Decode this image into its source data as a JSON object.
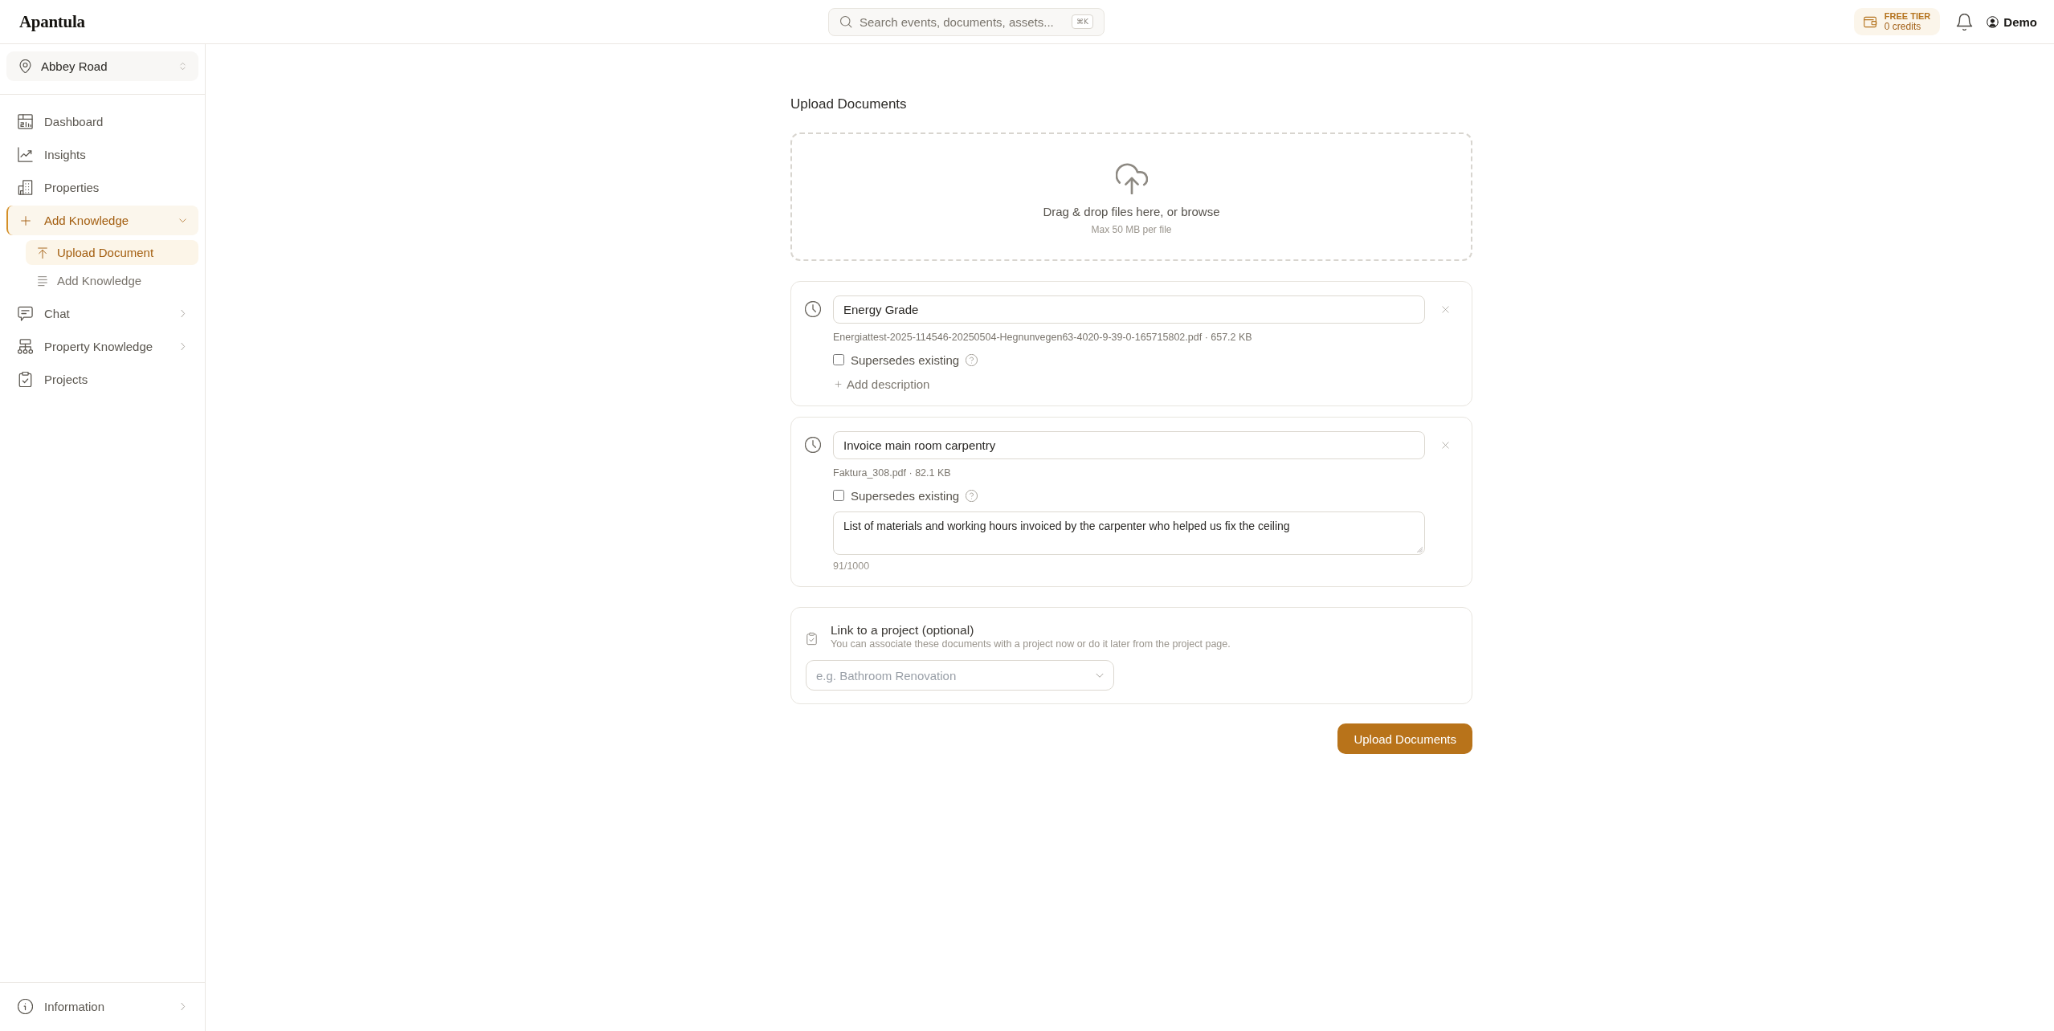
{
  "header": {
    "logo": "Apantula",
    "search": {
      "placeholder": "Search events, documents, assets...",
      "shortcut": "⌘K"
    },
    "plan": {
      "tier": "FREE TIER",
      "credits": "0 credits"
    },
    "user": "Demo"
  },
  "sidebar": {
    "location": "Abbey Road",
    "items": [
      {
        "kind": "link",
        "label": "Dashboard",
        "selected": false
      },
      {
        "kind": "link",
        "label": "Insights",
        "selected": false
      },
      {
        "kind": "link",
        "label": "Properties",
        "selected": false
      },
      {
        "kind": "group",
        "label": "Add Knowledge",
        "selected": true,
        "expanded": true,
        "children": [
          {
            "label": "Upload Document",
            "selected": true
          },
          {
            "label": "Add Knowledge",
            "selected": false
          }
        ]
      },
      {
        "kind": "group",
        "label": "Chat",
        "selected": false,
        "expanded": false
      },
      {
        "kind": "group",
        "label": "Property Knowledge",
        "selected": false,
        "expanded": false
      },
      {
        "kind": "link",
        "label": "Projects",
        "selected": false
      }
    ],
    "footer": {
      "label": "Information",
      "expanded": false
    }
  },
  "upload": {
    "title": "Upload Documents",
    "dropzone": {
      "prompt": "Drag & drop files here, or browse",
      "limit": "Max 50 MB per file"
    },
    "files": [
      {
        "title": "Energy Grade",
        "file_info": "Energiattest-2025-114546-20250504-Hegnunvegen63-4020-9-39-0-165715802.pdf · 657.2 KB",
        "supersedes": {
          "label": "Supersedes existing",
          "checked": false
        },
        "description": {
          "kind": "add",
          "label": "Add description"
        }
      },
      {
        "title": "Invoice main room carpentry",
        "file_info": "Faktura_308.pdf · 82.1 KB",
        "supersedes": {
          "label": "Supersedes existing",
          "checked": false
        },
        "description": {
          "kind": "text",
          "value": "List of materials and working hours invoiced by the carpenter who helped us fix the ceiling",
          "counter": "91/1000"
        }
      }
    ],
    "project": {
      "title": "Link to a project (optional)",
      "hint": "You can associate these documents with a project now or do it later from the project page.",
      "select": {
        "placeholder": "e.g. Bathroom Renovation"
      }
    },
    "submit": "Upload Documents"
  }
}
